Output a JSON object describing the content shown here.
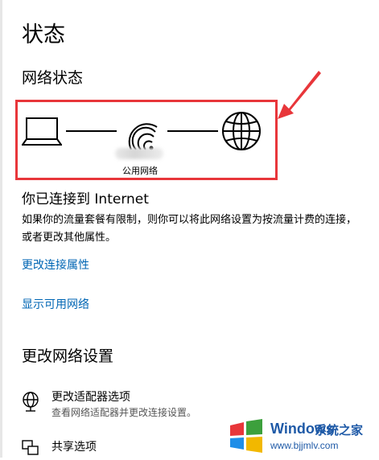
{
  "page": {
    "title": "状态"
  },
  "network_status": {
    "heading": "网络状态",
    "network_label": "公用网络"
  },
  "connection": {
    "title": "你已连接到 Internet",
    "description": "如果你的流量套餐有限制，则你可以将此网络设置为按流量计费的连接，或者更改其他属性。"
  },
  "links": {
    "change_properties": "更改连接属性",
    "show_networks": "显示可用网络"
  },
  "change_settings": {
    "heading": "更改网络设置",
    "options": [
      {
        "title": "更改适配器选项",
        "description": "查看网络适配器并更改连接设置。",
        "icon": "adapter-globe-icon"
      },
      {
        "title": "共享选项",
        "description": "",
        "icon": "sharing-icon"
      }
    ]
  },
  "watermark": {
    "brand": "Windows",
    "subtitle": "系统之家",
    "url": "www.bjjmlv.com"
  },
  "colors": {
    "link": "#0066b4",
    "highlight": "#e8363a",
    "watermark": "#1f5aa7"
  }
}
